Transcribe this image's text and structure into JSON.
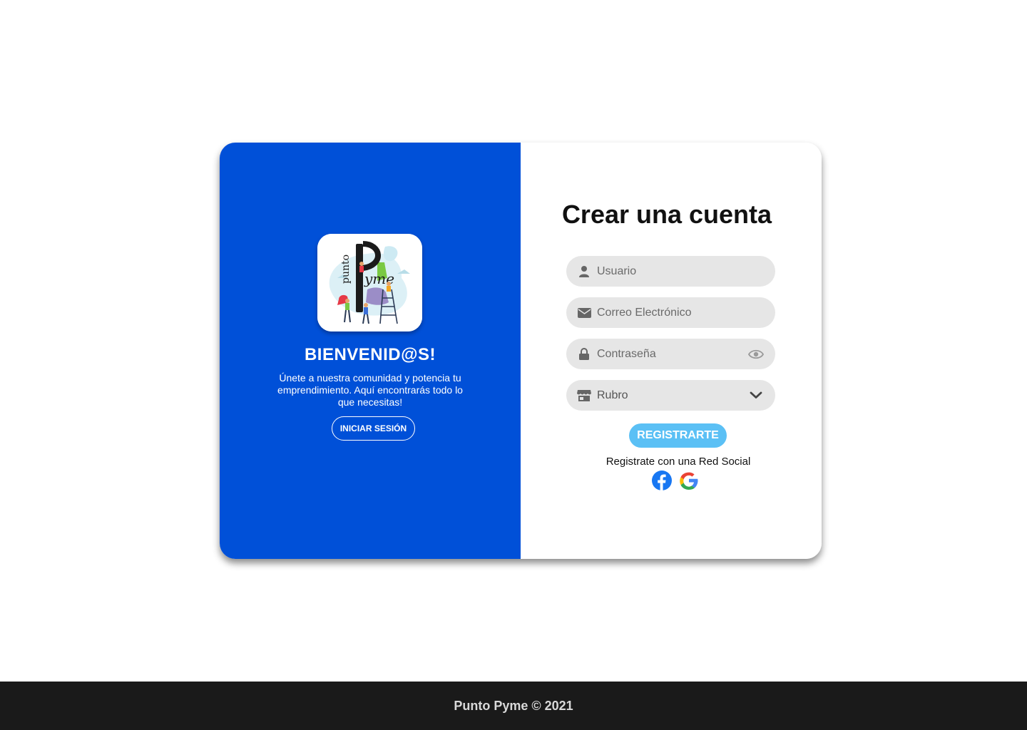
{
  "colors": {
    "left_panel_bg": "#0050d8",
    "register_button_bg": "#5bc0f5",
    "field_bg": "#e6e6e6",
    "footer_bg": "#1a1a1a"
  },
  "welcome": {
    "logo_icon": "punto-pyme-logo",
    "title": "BIENVENID@S!",
    "text": "Únete a nuestra comunidad y potencia tu emprendimiento. Aquí encontrarás todo lo que necesitas!",
    "login_label": "INICIAR SESIÓN"
  },
  "form": {
    "title": "Crear una cuenta",
    "fields": {
      "username": {
        "placeholder": "Usuario",
        "icon": "user-icon"
      },
      "email": {
        "placeholder": "Correo Electrónico",
        "icon": "envelope-icon"
      },
      "password": {
        "placeholder": "Contraseña",
        "icon": "lock-icon",
        "toggle_icon": "eye-icon"
      },
      "rubro": {
        "selected": "Rubro",
        "icon": "store-icon",
        "dropdown_icon": "chevron-down-icon"
      }
    },
    "register_label": "REGISTRARTE",
    "social_text": "Registrate con una Red Social",
    "social": [
      "facebook-icon",
      "google-icon"
    ]
  },
  "footer": {
    "text": "Punto Pyme © 2021"
  }
}
